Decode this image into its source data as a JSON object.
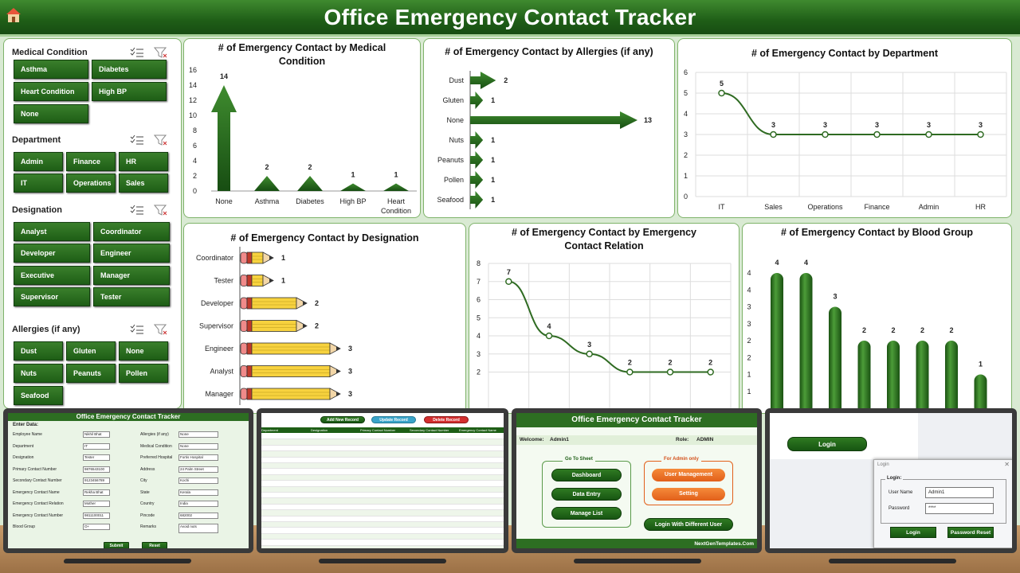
{
  "header": {
    "title": "Office Emergency Contact Tracker"
  },
  "slicers": {
    "medical": {
      "title": "Medical Condition",
      "items": [
        "Asthma",
        "Diabetes",
        "Heart Condition",
        "High BP",
        "None"
      ]
    },
    "department": {
      "title": "Department",
      "items": [
        "Admin",
        "Finance",
        "HR",
        "IT",
        "Operations",
        "Sales"
      ]
    },
    "designation": {
      "title": "Designation",
      "items": [
        "Analyst",
        "Coordinator",
        "Developer",
        "Engineer",
        "Executive",
        "Manager",
        "Supervisor",
        "Tester"
      ]
    },
    "allergies": {
      "title": "Allergies (if any)",
      "items": [
        "Dust",
        "Gluten",
        "None",
        "Nuts",
        "Peanuts",
        "Pollen",
        "Seafood"
      ]
    }
  },
  "chart_data": [
    {
      "type": "bar",
      "title": "# of Emergency Contact  by Medical Condition",
      "categories": [
        "None",
        "Asthma",
        "Diabetes",
        "High BP",
        "Heart Condition"
      ],
      "values": [
        14,
        2,
        2,
        1,
        1
      ],
      "ylim": [
        0,
        16
      ],
      "yticks": [
        0,
        2,
        4,
        6,
        8,
        10,
        12,
        14,
        16
      ]
    },
    {
      "type": "bar",
      "orientation": "horizontal",
      "title": "# of Emergency Contact  by Allergies (if any)",
      "categories": [
        "Dust",
        "Gluten",
        "None",
        "Nuts",
        "Peanuts",
        "Pollen",
        "Seafood"
      ],
      "values": [
        2,
        1,
        13,
        1,
        1,
        1,
        1
      ]
    },
    {
      "type": "line",
      "title": "# of Emergency Contact  by Department",
      "categories": [
        "IT",
        "Sales",
        "Operations",
        "Finance",
        "Admin",
        "HR"
      ],
      "values": [
        5,
        3,
        3,
        3,
        3,
        3
      ],
      "ylim": [
        0,
        6
      ],
      "yticks": [
        0,
        1,
        2,
        3,
        4,
        5,
        6
      ]
    },
    {
      "type": "bar",
      "orientation": "horizontal",
      "title": "# of Emergency Contact  by Designation",
      "categories": [
        "Coordinator",
        "Tester",
        "Developer",
        "Supervisor",
        "Engineer",
        "Analyst",
        "Manager"
      ],
      "values": [
        1,
        1,
        2,
        2,
        3,
        3,
        3
      ]
    },
    {
      "type": "line",
      "title": "# of Emergency Contact  by Emergency Contact Relation",
      "values": [
        7,
        4,
        3,
        2,
        2,
        2
      ],
      "ylim": [
        0,
        8
      ],
      "yticks": [
        2,
        3,
        4,
        5,
        6,
        7,
        8
      ]
    },
    {
      "type": "bar",
      "title": "# of Emergency Contact  by Blood Group",
      "values": [
        4,
        4,
        3,
        2,
        2,
        2,
        2,
        1
      ],
      "ylim": [
        0,
        4
      ],
      "yticks": [
        1,
        1,
        2,
        2,
        3,
        3,
        4,
        4
      ]
    }
  ],
  "screens": {
    "form": {
      "title": "Office Emergency Contact Tracker",
      "section": "Enter Data:",
      "fields_left": [
        "Employee Name",
        "Department",
        "Designation",
        "Primary Contact Number",
        "Secondary Contact Number",
        "Emergency Contact Name",
        "Emergency Contact Relation",
        "Emergency Contact Number",
        "Blood Group"
      ],
      "values_left": [
        "Nikhil Bhat",
        "IT",
        "Tester",
        "9876543100",
        "9123456789",
        "Rekha Bhat",
        "Mother",
        "9811100011",
        "O+"
      ],
      "fields_right": [
        "Allergies (if any)",
        "Medical Condition",
        "Preferred Hospital",
        "Address",
        "City",
        "State",
        "Country",
        "Pincode",
        "Remarks"
      ],
      "values_right": [
        "None",
        "None",
        "Fortis Hospital",
        "24 Palm Street",
        "Kochi",
        "Kerala",
        "India",
        "682002",
        "Avoid nuts"
      ],
      "submit": "Submit",
      "reset": "Reset"
    },
    "table": {
      "add": "Add New Record",
      "update": "Update Record",
      "delete": "Delete Record",
      "headers": [
        "Department",
        "Designation",
        "Primary Contact Number",
        "Secondary Contact Number",
        "Emergency Contact Name",
        "Emergency Cont"
      ]
    },
    "menu": {
      "title": "Office Emergency Contact Tracker",
      "welcome": "Welcome:",
      "user": "Admin1",
      "role_label": "Role:",
      "role": "ADMIN",
      "goto": "Go To Sheet",
      "dashboard": "Dashboard",
      "data_entry": "Data Entry",
      "manage": "Manage List",
      "admin_only": "For Admin only",
      "user_mgmt": "User Management",
      "setting": "Setting",
      "login_diff": "Login With Different User",
      "footer": "NextGenTemplates.Com"
    },
    "login": {
      "button": "Login",
      "dialog_title": "Login",
      "group": "Login:",
      "user_label": "User Name",
      "user_value": "Admin1",
      "pass_label": "Password",
      "pass_value": "****",
      "login": "Login",
      "reset": "Password Reset"
    }
  }
}
